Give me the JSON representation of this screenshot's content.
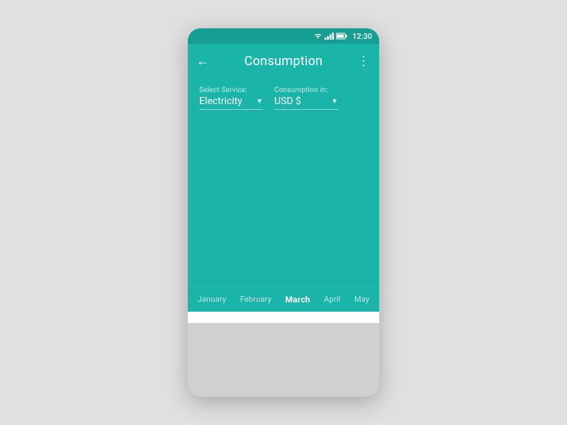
{
  "statusBar": {
    "time": "12:30"
  },
  "appBar": {
    "title": "Consumption",
    "backLabel": "←",
    "moreLabel": "⋮"
  },
  "selectors": {
    "service": {
      "label": "Select Service:",
      "value": "Electricity"
    },
    "consumption": {
      "label": "Consumption in:",
      "value": "USD $"
    }
  },
  "months": {
    "items": [
      {
        "label": "January",
        "active": false
      },
      {
        "label": "February",
        "active": false
      },
      {
        "label": "March",
        "active": true
      },
      {
        "label": "April",
        "active": false
      },
      {
        "label": "May",
        "active": false
      }
    ]
  },
  "colors": {
    "teal": "#1ab5a8",
    "tealDark": "#179e93",
    "white": "#ffffff",
    "gray": "#d0d0d0"
  }
}
